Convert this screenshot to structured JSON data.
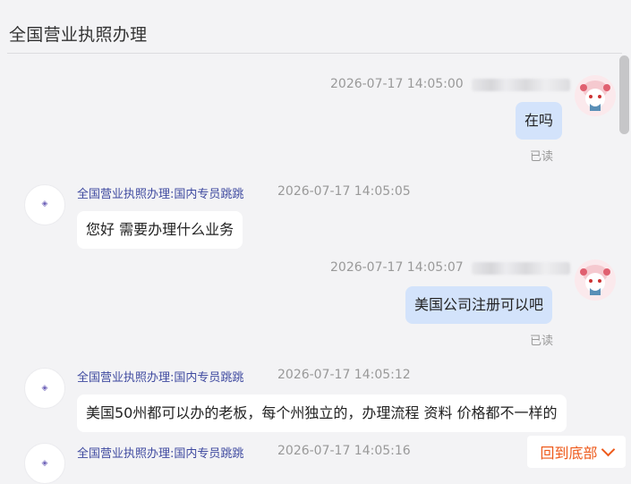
{
  "header": {
    "title": "全国营业执照办理"
  },
  "messages": [
    {
      "time": "2026-07-17 14:05:00",
      "text": "在吗",
      "read": "已读"
    },
    {
      "sender": "全国营业执照办理:国内专员跳跳",
      "time": "2026-07-17 14:05:05",
      "text": "您好 需要办理什么业务"
    },
    {
      "time": "2026-07-17 14:05:07",
      "text": "美国公司注册可以吧",
      "read": "已读"
    },
    {
      "sender": "全国营业执照办理:国内专员跳跳",
      "time": "2026-07-17 14:05:12",
      "text": "美国50州都可以办的老板，每个州独立的，办理流程 资料 价格都不一样的"
    },
    {
      "sender": "全国营业执照办理:国内专员跳跳",
      "time": "2026-07-17 14:05:16"
    }
  ],
  "scroll_button": {
    "label": "回到底部",
    "icon": "chevron-down-icon"
  },
  "colors": {
    "outgoing_bubble": "#d3e3fb",
    "sender_name": "#3f4aa0",
    "accent": "#ee5a1b"
  }
}
